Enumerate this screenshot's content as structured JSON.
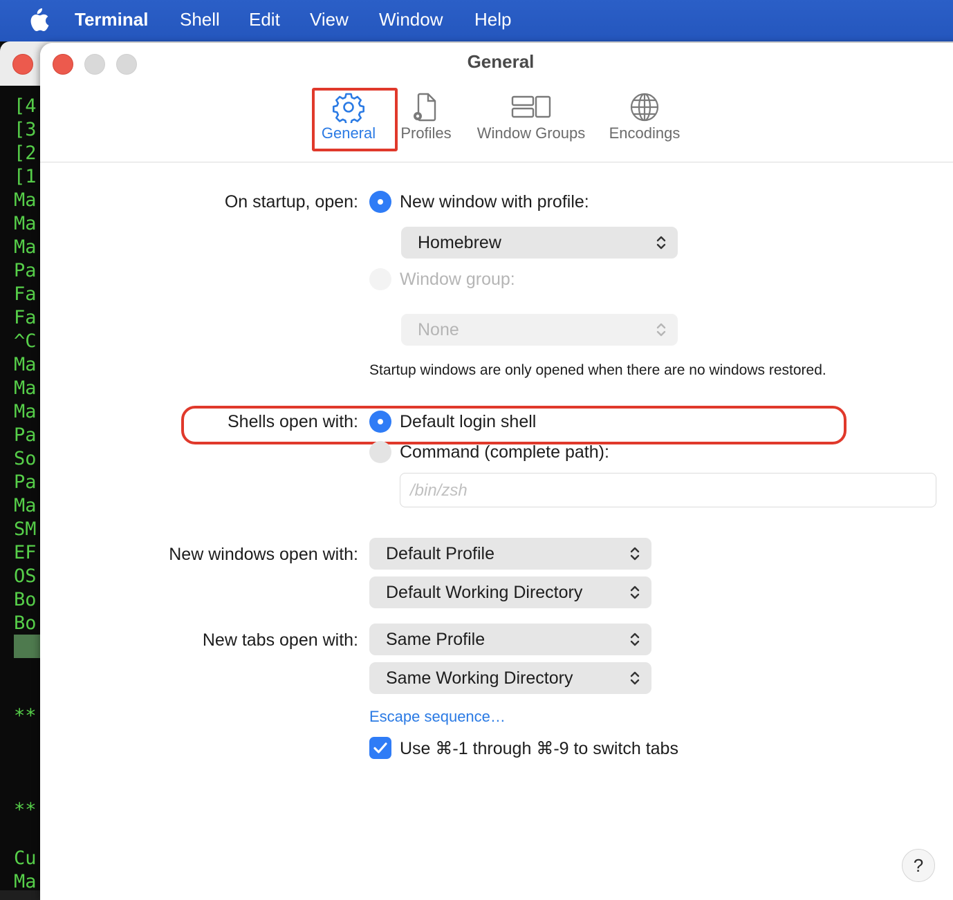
{
  "menubar": {
    "app_name": "Terminal",
    "items": [
      "Shell",
      "Edit",
      "View",
      "Window",
      "Help"
    ]
  },
  "terminal_lines": [
    "[4",
    "[3",
    "[2",
    "[1",
    "Ma",
    "Ma",
    "Ma",
    "Pa",
    "Fa",
    "Fa",
    "^C",
    "Ma",
    "Ma",
    "Ma",
    "Pa",
    "So",
    "Pa",
    "Ma",
    "SM",
    "EF",
    "OS",
    "Bo",
    "Bo",
    "**",
    "**",
    "Cu",
    "Ma"
  ],
  "window": {
    "title": "General",
    "tabs": [
      {
        "label": "General",
        "icon": "gear-icon",
        "selected": true
      },
      {
        "label": "Profiles",
        "icon": "profile-document-icon"
      },
      {
        "label": "Window Groups",
        "icon": "window-groups-icon"
      },
      {
        "label": "Encodings",
        "icon": "globe-icon"
      }
    ]
  },
  "startup": {
    "label": "On startup, open:",
    "option_profile": "New window with profile:",
    "profile_value": "Homebrew",
    "option_group": "Window group:",
    "group_value": "None",
    "note": "Startup windows are only opened when there are no windows restored."
  },
  "shells": {
    "label": "Shells open with:",
    "option_default": "Default login shell",
    "option_command": "Command (complete path):",
    "command_placeholder": "/bin/zsh"
  },
  "new_windows": {
    "label": "New windows open with:",
    "profile_value": "Default Profile",
    "directory_value": "Default Working Directory"
  },
  "new_tabs": {
    "label": "New tabs open with:",
    "profile_value": "Same Profile",
    "directory_value": "Same Working Directory"
  },
  "escape_sequence_link": "Escape sequence…",
  "switch_tabs_checkbox": {
    "label": "Use ⌘-1 through ⌘-9 to switch tabs",
    "checked": true
  },
  "help_button": "?",
  "colors": {
    "accent": "#2f7cf6",
    "highlight_box": "#e0392b",
    "menubar": "#2456bd",
    "terminal_text": "#57d04a"
  }
}
